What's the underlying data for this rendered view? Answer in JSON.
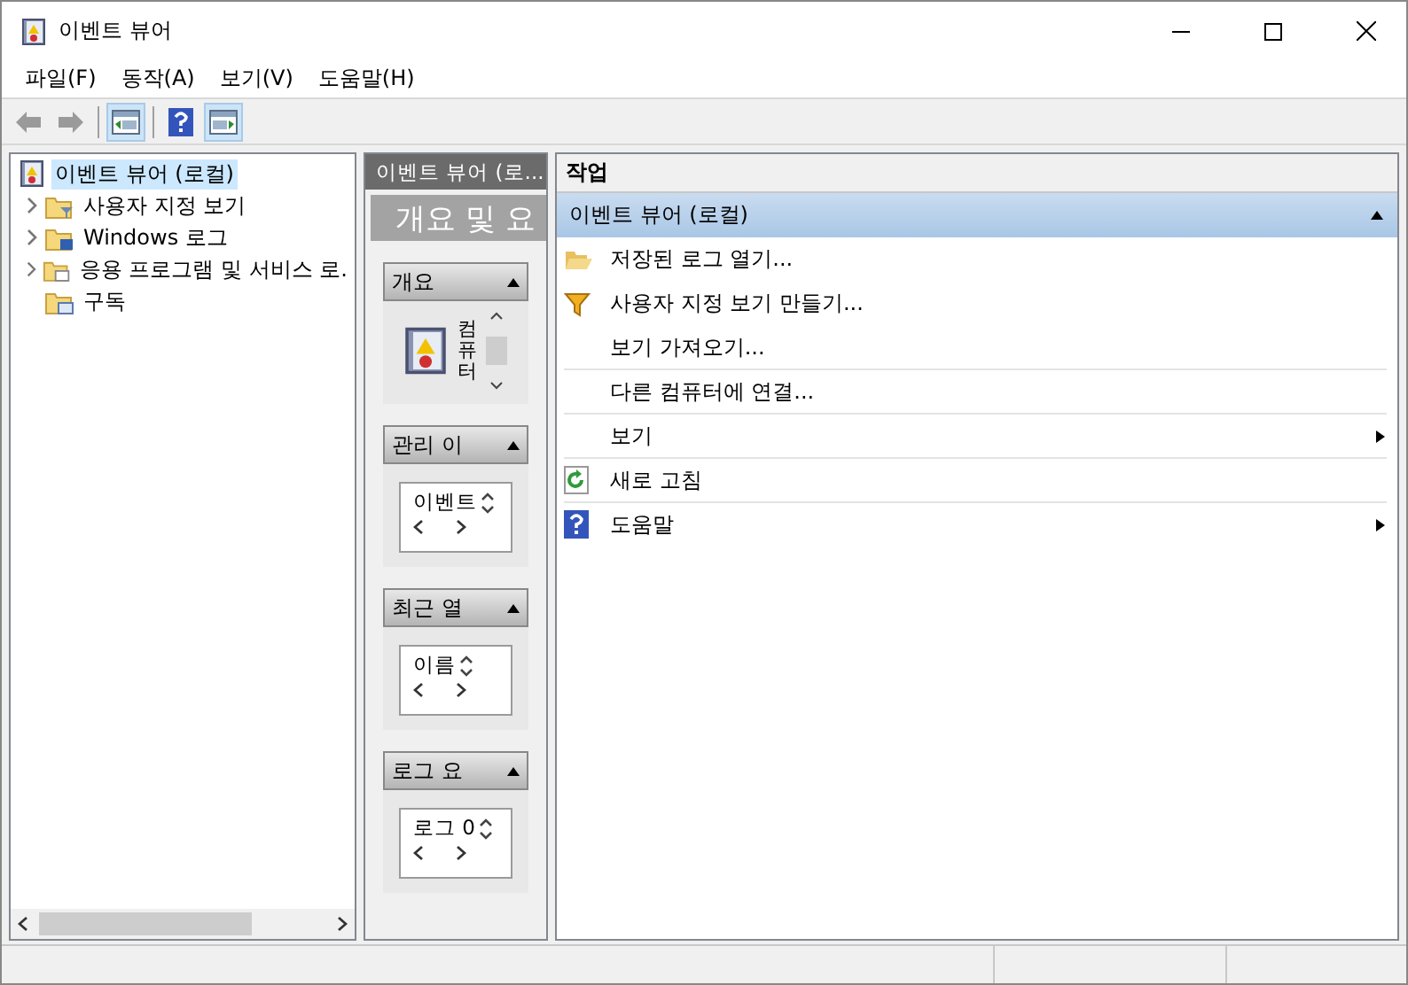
{
  "window": {
    "title": "이벤트 뷰어"
  },
  "menu": [
    "파일(F)",
    "동작(A)",
    "보기(V)",
    "도움말(H)"
  ],
  "toolbar": [
    {
      "kind": "back",
      "selected": false
    },
    {
      "kind": "forward",
      "selected": false
    },
    {
      "kind": "tree-toggle",
      "selected": true
    },
    {
      "kind": "help",
      "selected": false
    },
    {
      "kind": "actions-toggle",
      "selected": true
    }
  ],
  "tree": {
    "label": "이벤트 뷰어 (로컬)",
    "selected": true,
    "children": [
      {
        "label": "사용자 지정 보기",
        "kind": "filter-folder",
        "has_children": true,
        "expanded": false
      },
      {
        "label": "Windows 로그",
        "kind": "log-folder",
        "has_children": true,
        "expanded": false
      },
      {
        "label": "응용 프로그램 및 서비스 로.",
        "kind": "app-folder",
        "has_children": true,
        "expanded": false
      },
      {
        "label": "구독",
        "kind": "sub-folder",
        "has_children": false
      }
    ]
  },
  "middle": {
    "header": "이벤트 뷰어 (로...",
    "title": "개요 및 요",
    "sections": [
      {
        "kind": "overview",
        "title": "개요",
        "text": "컴퓨터",
        "expanded": true
      },
      {
        "kind": "list",
        "title": "관리 이",
        "cell": "이벤트",
        "expanded": true
      },
      {
        "kind": "list",
        "title": "최근 열",
        "cell": "이름",
        "expanded": true
      },
      {
        "kind": "list",
        "title": "로그 요",
        "cell": "로그 0",
        "expanded": true
      }
    ]
  },
  "actions": {
    "header": "작업",
    "group": {
      "title": "이벤트 뷰어 (로컬)",
      "expanded": true
    },
    "items": [
      {
        "label": "저장된 로그 열기...",
        "kind": "folder",
        "submenu": false,
        "divider": false
      },
      {
        "label": "사용자 지정 보기 만들기...",
        "kind": "filter",
        "submenu": false,
        "divider": false
      },
      {
        "label": "보기 가져오기...",
        "kind": "none",
        "submenu": false,
        "divider": true
      },
      {
        "label": "다른 컴퓨터에 연결...",
        "kind": "none",
        "submenu": false,
        "divider": true
      },
      {
        "label": "보기",
        "kind": "none",
        "submenu": true,
        "divider": true
      },
      {
        "label": "새로 고침",
        "kind": "refresh",
        "submenu": false,
        "divider": true
      },
      {
        "label": "도움말",
        "kind": "help",
        "submenu": true,
        "divider": false
      }
    ]
  }
}
